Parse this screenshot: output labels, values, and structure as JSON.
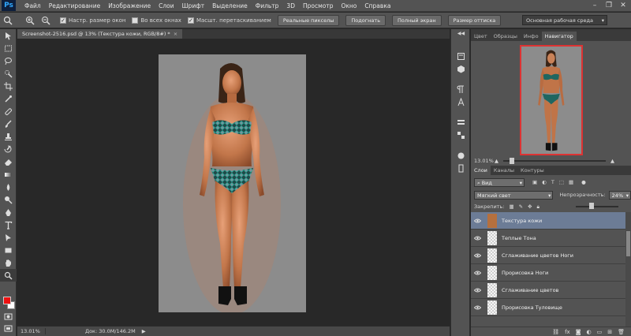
{
  "app": {
    "logo": "Ps"
  },
  "menu": [
    "Файл",
    "Редактирование",
    "Изображение",
    "Слои",
    "Шрифт",
    "Выделение",
    "Фильтр",
    "3D",
    "Просмотр",
    "Окно",
    "Справка"
  ],
  "window_controls": {
    "minimize": "–",
    "restore": "❐",
    "close": "✕"
  },
  "options": {
    "check1": "Настр. размер окон",
    "check2": "Во всех окнах",
    "check3": "Масшт. перетаскиванием",
    "btn_actual": "Реальные пикселы",
    "btn_fit": "Подогнать",
    "btn_full": "Полный экран",
    "btn_print": "Размер оттиска",
    "workspace": "Основная рабочая среда"
  },
  "document": {
    "tab_title": "Screenshot-2516.psd @ 13% (Текстура кожи, RGB/8#) *",
    "tab_close": "×",
    "status_zoom": "13.01%",
    "status_doc": "Док: 30.0M/146.2M",
    "status_arrow": "▶"
  },
  "navigator": {
    "tabs": [
      "Цвет",
      "Образцы",
      "Инфо",
      "Навигатор"
    ],
    "zoom": "13.01%"
  },
  "layers_panel": {
    "tabs": [
      "Слои",
      "Каналы",
      "Контуры"
    ],
    "filter": "Вид",
    "blend_mode": "Мягкий свет",
    "opacity_label": "Непрозрачность:",
    "opacity_value": "24%",
    "lock_label": "Закрепить:",
    "layers": [
      {
        "name": "Текстура кожи",
        "selected": true
      },
      {
        "name": "Теплые Тона",
        "selected": false
      },
      {
        "name": "Сглаживание цветов Ноги",
        "selected": false
      },
      {
        "name": "Прорисовка Ноги",
        "selected": false
      },
      {
        "name": "Сглаживание цветов",
        "selected": false
      },
      {
        "name": "Прорисовка Туловище",
        "selected": false
      }
    ],
    "bottom_icons": [
      "link-icon",
      "fx-icon",
      "mask-icon",
      "adjustment-icon",
      "folder-icon",
      "new-layer-icon",
      "trash-icon"
    ]
  }
}
